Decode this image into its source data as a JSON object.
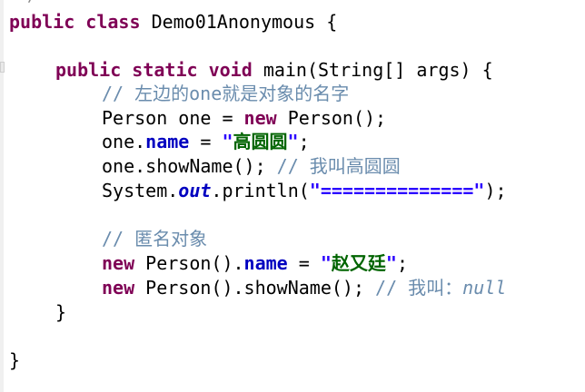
{
  "code": {
    "prev_line_fragment": "/",
    "line_class": {
      "kw_public": "public",
      "kw_class": "class",
      "class_name": "Demo01Anonymous",
      "brace": "{"
    },
    "line_main": {
      "kw_public": "public",
      "kw_static": "static",
      "kw_void": "void",
      "signature": "main(String[] args) {"
    },
    "line_comment1": "// 左边的one就是对象的名字",
    "line_decl": {
      "type_and_var": "Person one = ",
      "kw_new": "new",
      "ctor": "Person();"
    },
    "line_assign1": {
      "obj": "one.",
      "field": "name",
      "op": " = ",
      "quote_open": "\"",
      "value": "高圆圆",
      "quote_close": "\"",
      "semi": ";"
    },
    "line_call1": {
      "code": "one.showName(); ",
      "comment": "// 我叫高圆圆"
    },
    "line_print": {
      "prefix": "System.",
      "field": "out",
      "method": ".println(",
      "string": "\"==============\"",
      "suffix": ");"
    },
    "line_comment2": "// 匿名对象",
    "line_anon1": {
      "kw_new": "new",
      "ctor": " Person().",
      "field": "name",
      "op": " = ",
      "quote_open": "\"",
      "value": "赵又廷",
      "quote_close": "\"",
      "semi": ";"
    },
    "line_anon2": {
      "kw_new": "new",
      "call": " Person().showName(); ",
      "comment": "// 我叫：",
      "comment_null": "null"
    },
    "close_method": "}",
    "close_class": "}"
  },
  "colors": {
    "keyword": "#7f0055",
    "comment": "#6a8cad",
    "string": "#2a00ff",
    "field": "#0000c0",
    "chinese_string": "#006400"
  }
}
